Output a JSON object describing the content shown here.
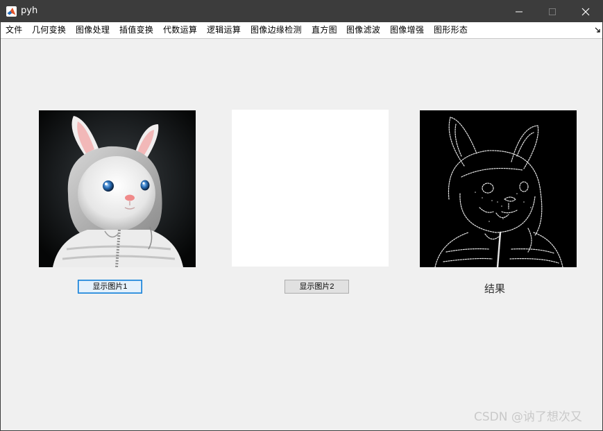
{
  "window": {
    "title": "pyh",
    "icon": "matlab-icon",
    "controls": [
      "minimize-icon",
      "maximize-icon",
      "close-icon"
    ]
  },
  "menu": {
    "items": [
      "文件",
      "几何变换",
      "图像处理",
      "插值变换",
      "代数运算",
      "逻辑运算",
      "图像边缘检测",
      "直方图",
      "图像滤波",
      "图像增强",
      "图形形态"
    ],
    "overflow_icon": "dock-arrow-icon"
  },
  "panels": {
    "image1": {
      "content": "white-rabbit-in-hoodie-photo"
    },
    "image2": {
      "content": "blank-white"
    },
    "result": {
      "content": "edge-detection-result-black"
    }
  },
  "buttons": {
    "show1": "显示图片1",
    "show2": "显示图片2"
  },
  "labels": {
    "result": "结果"
  },
  "watermark": "CSDN @讷了想次又",
  "colors": {
    "titlebar": "#3c3c3c",
    "background": "#f0f0f0",
    "focus": "#0078d7"
  }
}
